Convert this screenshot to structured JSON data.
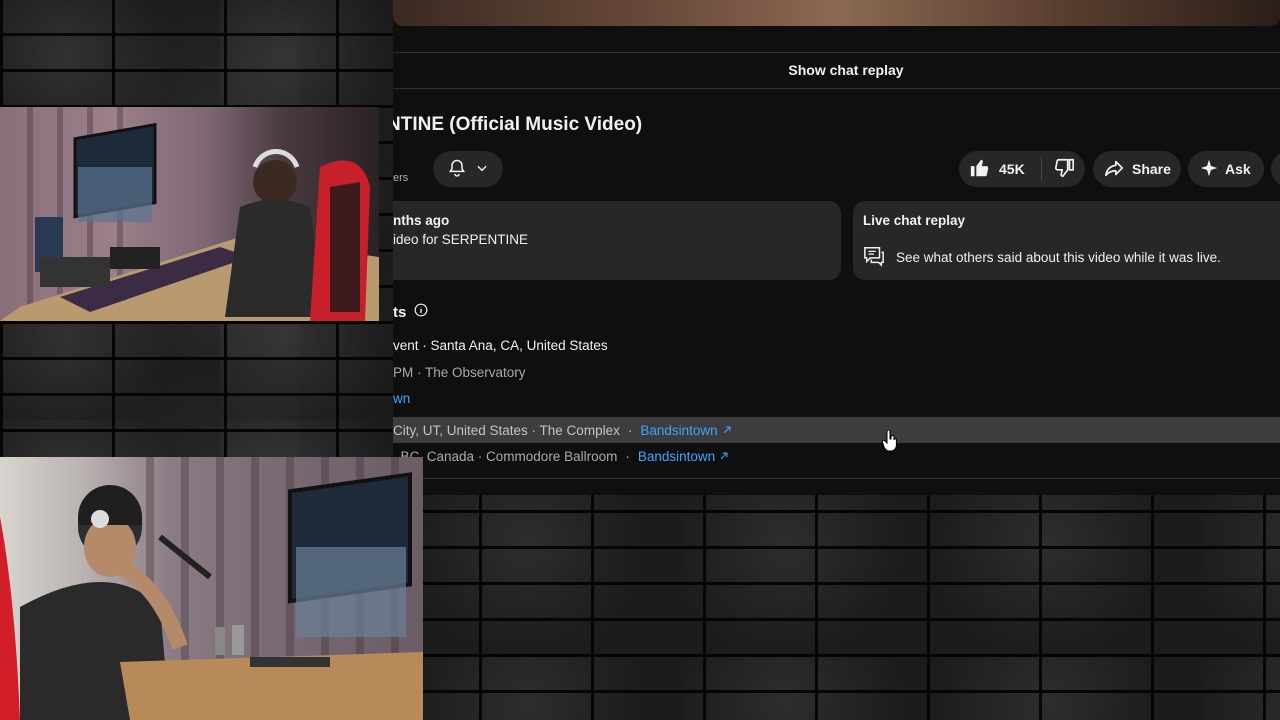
{
  "video": {
    "show_chat_replay_label": "Show chat replay",
    "title_fragment": "NTINE (Official Music Video)",
    "subscribers_fragment": "ers"
  },
  "actions": {
    "like_count": "45K",
    "share_label": "Share",
    "ask_label": "Ask"
  },
  "description_card": {
    "date_fragment": "nths ago",
    "text_fragment": "ideo for SERPENTINE"
  },
  "live_chat_card": {
    "title": "Live chat replay",
    "text": "See what others said about this video while it was live."
  },
  "events": {
    "heading_fragment": "ts",
    "event1_title": "vent · Santa Ana, CA, United States",
    "event1_detail": "PM · The Observatory",
    "event1_link": "wn",
    "event2_location": "City, UT, United States · The Complex",
    "event2_link": "Bandsintown",
    "event3_location": ", BC, Canada · Commodore Ballroom",
    "event3_link": "Bandsintown"
  },
  "colors": {
    "link": "#3ea6ff",
    "background": "#0f0f0f",
    "pill": "#272727"
  }
}
